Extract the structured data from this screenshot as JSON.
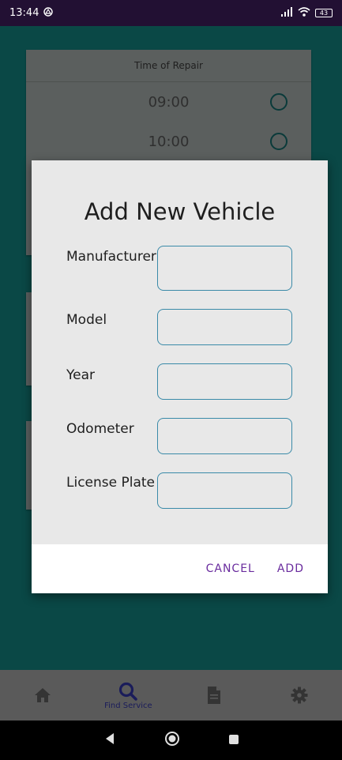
{
  "status_bar": {
    "time": "13:44",
    "battery": "43"
  },
  "background": {
    "time_card": {
      "header": "Time of Repair",
      "times": [
        "09:00",
        "10:00"
      ]
    }
  },
  "dialog": {
    "title": "Add New Vehicle",
    "fields": [
      {
        "label": "Manufacturer",
        "value": "",
        "placeholder": ""
      },
      {
        "label": "Model",
        "value": "",
        "placeholder": ""
      },
      {
        "label": "Year",
        "value": "",
        "placeholder": ""
      },
      {
        "label": "Odometer",
        "value": "",
        "placeholder": ""
      },
      {
        "label": "License Plate",
        "value": "",
        "placeholder": ""
      }
    ],
    "cancel_label": "CANCEL",
    "add_label": "ADD"
  },
  "bottom_nav": {
    "items": [
      {
        "icon": "home-icon",
        "label": ""
      },
      {
        "icon": "search-icon",
        "label": "Find Service"
      },
      {
        "icon": "document-icon",
        "label": ""
      },
      {
        "icon": "gear-icon",
        "label": ""
      }
    ],
    "active_index": 1
  },
  "colors": {
    "status_bar": "#221033",
    "accent_button": "#6a2c9e",
    "input_border": "#3a8aa8",
    "active_nav": "#1a1c5a"
  }
}
